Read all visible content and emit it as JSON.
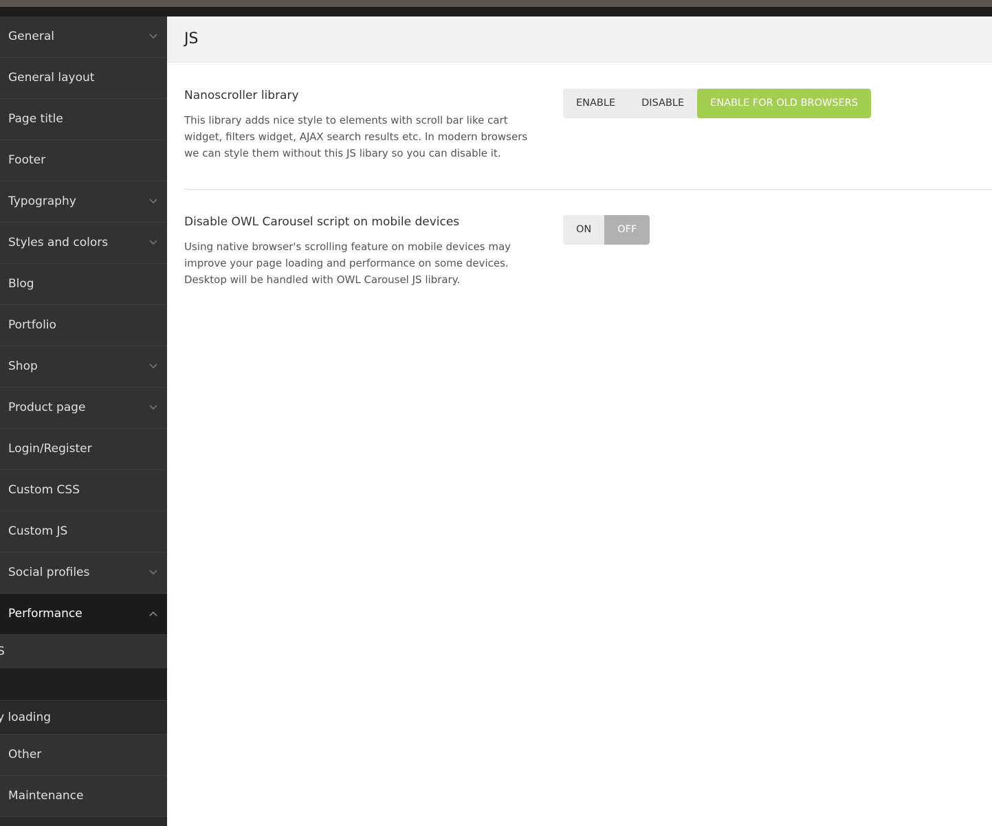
{
  "sidebar": {
    "items": [
      {
        "label": "General",
        "chevron": "chevron-down-icon"
      },
      {
        "label": "General layout"
      },
      {
        "label": "Page title"
      },
      {
        "label": "Footer"
      },
      {
        "label": "Typography",
        "chevron": "chevron-down-icon"
      },
      {
        "label": "Styles and colors",
        "chevron": "chevron-down-icon"
      },
      {
        "label": "Blog"
      },
      {
        "label": "Portfolio"
      },
      {
        "label": "Shop",
        "chevron": "chevron-down-icon"
      },
      {
        "label": "Product page",
        "chevron": "chevron-down-icon"
      },
      {
        "label": "Login/Register"
      },
      {
        "label": "Custom CSS"
      },
      {
        "label": "Custom JS"
      },
      {
        "label": "Social profiles",
        "chevron": "chevron-down-icon"
      },
      {
        "label": "Performance",
        "chevron": "chevron-up-icon",
        "active": true
      }
    ],
    "subitems": [
      {
        "label": "S"
      },
      {
        "label": ""
      },
      {
        "label": "y loading"
      }
    ],
    "bottom_items": [
      {
        "label": "Other"
      },
      {
        "label": "Maintenance"
      }
    ]
  },
  "main": {
    "title": "JS",
    "options": [
      {
        "label": "Nanoscroller library",
        "description": "This library adds nice style to elements with scroll bar like cart widget, filters widget, AJAX search results etc. In modern browsers we can style them without this JS libary so you can disable it.",
        "buttons": [
          "ENABLE",
          "DISABLE",
          "ENABLE FOR OLD BROWSERS"
        ],
        "selected": "ENABLE FOR OLD BROWSERS"
      },
      {
        "label": "Disable OWL Carousel script on mobile devices",
        "description": "Using native browser's scrolling feature on mobile devices may improve your page loading and performance on some devices. Desktop will be handled with OWL Carousel JS library.",
        "buttons": [
          "ON",
          "OFF"
        ],
        "selected": "OFF"
      }
    ]
  },
  "colors": {
    "accent_green": "#a2cf4f",
    "sidebar_bg": "#323232",
    "sidebar_active": "#1c1c1c"
  }
}
